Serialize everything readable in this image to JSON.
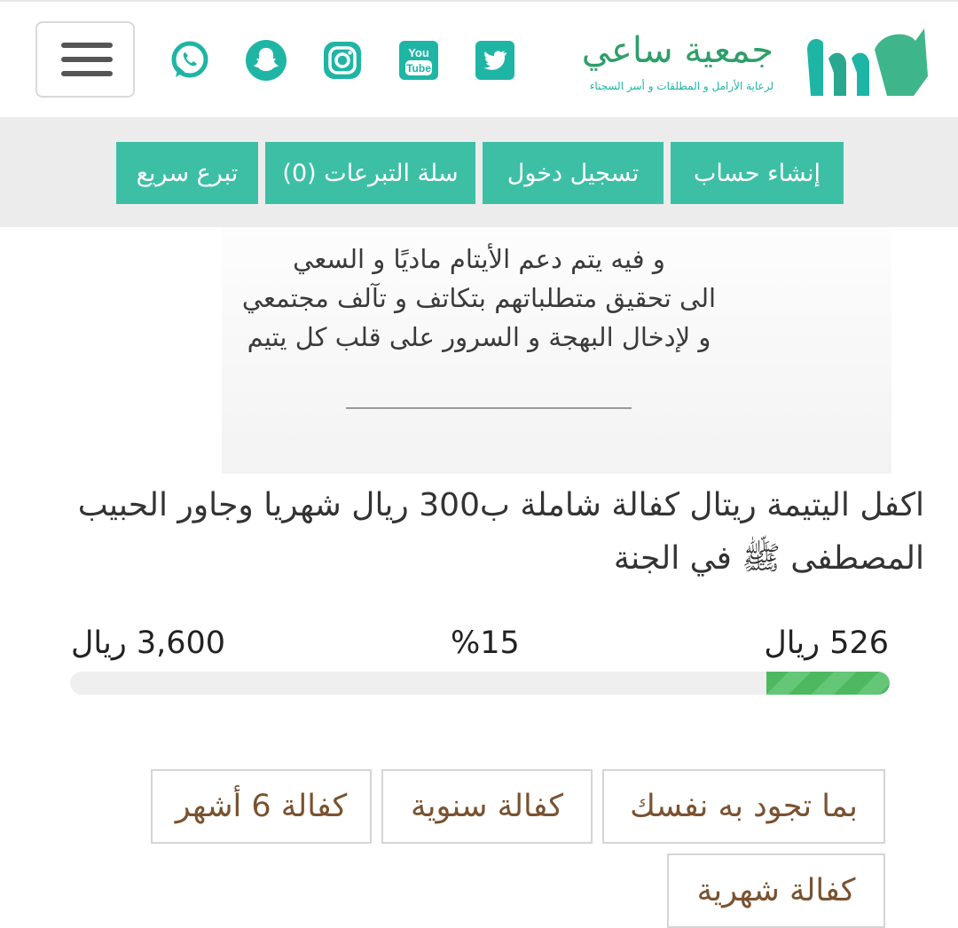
{
  "header": {
    "logo_name": "جمعية ساعي",
    "logo_subtitle": "لرعاية الأرامل و المطلقات و أسر السجناء",
    "menu_icon": "hamburger-icon",
    "social": [
      {
        "name": "whatsapp",
        "icon": "whatsapp-icon"
      },
      {
        "name": "snapchat",
        "icon": "snapchat-icon"
      },
      {
        "name": "instagram",
        "icon": "instagram-icon"
      },
      {
        "name": "youtube",
        "icon": "youtube-icon",
        "text_top": "You",
        "text_bottom": "Tube"
      },
      {
        "name": "twitter",
        "icon": "twitter-icon"
      }
    ]
  },
  "nav": {
    "register": "إنشاء حساب",
    "login": "تسجيل دخول",
    "cart": "سلة التبرعات (0)",
    "quick_donate": "تبرع سريع"
  },
  "banner": {
    "lines": [
      "و فيه يتم دعم الأيتام ماديًا و السعي",
      "الى تحقيق متطلباتهم بتكاتف و تآلف مجتمعي",
      "و لإدخال البهجة و السرور  على قلب كل يتيم"
    ]
  },
  "campaign": {
    "title": "اكفل اليتيمة ريتال كفالة شاملة ب300 ريال شهريا وجاور الحبيب المصطفى ﷺ في الجنة",
    "raised": "526 ريال",
    "percent": "%15",
    "goal": "3,600 ريال",
    "progress_fraction": 0.15
  },
  "options": {
    "free_amount": "بما تجود به نفسك",
    "yearly": "كفالة سنوية",
    "six_months": "كفالة 6 أشهر",
    "monthly": "كفالة شهرية"
  },
  "colors": {
    "brand_teal": "#3dbfa6",
    "icon_teal": "#1fb5a5",
    "progress_green": "#4db860",
    "option_text": "#7a5230"
  }
}
